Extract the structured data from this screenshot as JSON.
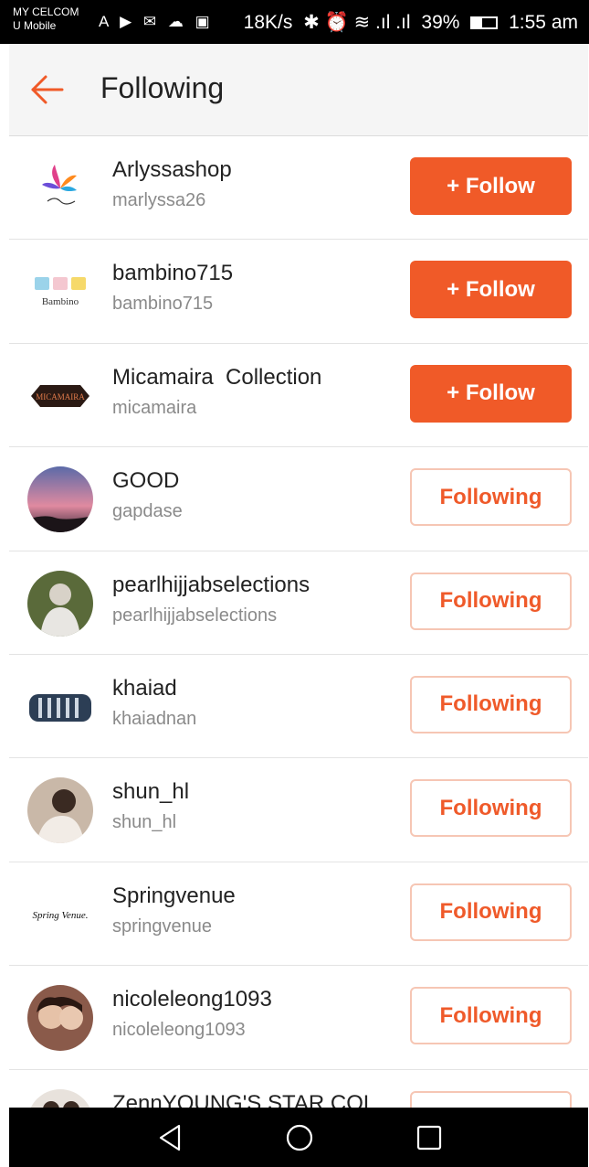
{
  "status_bar": {
    "carrier_line1": "MY CELCOM",
    "carrier_line2": "U Mobile",
    "notification_icons": "A ▶ ✉ ☁ ▣",
    "speed": "18K/s",
    "misc_icons": "✱ ⏰ ≋ .ıl .ıl",
    "battery": "39%",
    "time": "1:55 am"
  },
  "app_bar": {
    "title": "Following",
    "accent_color": "#f05a28"
  },
  "list": [
    {
      "name": "Arlyssashop",
      "handle": "marlyssa26",
      "button": "+ Follow",
      "state": "follow"
    },
    {
      "name": "bambino715",
      "handle": "bambino715",
      "button": "+ Follow",
      "state": "follow"
    },
    {
      "name": "Micamaira  Collection",
      "handle": "micamaira",
      "button": "+ Follow",
      "state": "follow"
    },
    {
      "name": "GOOD",
      "handle": "gapdase",
      "button": "Following",
      "state": "following"
    },
    {
      "name": "pearlhijjabselections",
      "handle": "pearlhijjabselections",
      "button": "Following",
      "state": "following"
    },
    {
      "name": "khaiad",
      "handle": "khaiadnan",
      "button": "Following",
      "state": "following"
    },
    {
      "name": "shun_hl",
      "handle": "shun_hl",
      "button": "Following",
      "state": "following"
    },
    {
      "name": "Springvenue",
      "handle": "springvenue",
      "button": "Following",
      "state": "following"
    },
    {
      "name": "nicoleleong1093",
      "handle": "nicoleleong1093",
      "button": "Following",
      "state": "following"
    },
    {
      "name": "ZennYOUNG'S STAR COL",
      "handle": "",
      "button": "",
      "state": "following"
    }
  ],
  "logos": {
    "bambino_text": "Bambino",
    "micamaira_text": "MICAMAIRA",
    "springvenue_text": "Spring Venue."
  },
  "nav_bar": {
    "icons": [
      "back-triangle-icon",
      "home-circle-icon",
      "recents-square-icon"
    ]
  }
}
